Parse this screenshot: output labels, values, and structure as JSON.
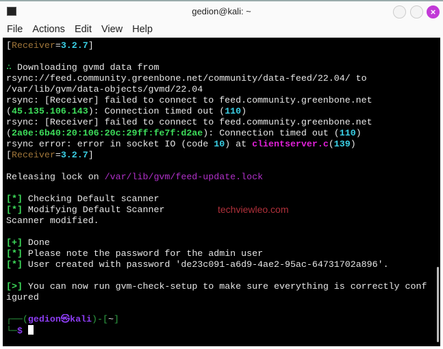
{
  "window": {
    "title": "gedion@kali: ~",
    "close_glyph": "×"
  },
  "menu": [
    "File",
    "Actions",
    "Edit",
    "View",
    "Help"
  ],
  "watermark": "techviewleo.com",
  "terminal": {
    "lines": [
      [
        [
          "",
          "["
        ],
        [
          "rcv",
          "Receiver"
        ],
        [
          "",
          "="
        ],
        [
          "cy",
          "3.2.7"
        ],
        [
          "",
          "]"
        ]
      ],
      [],
      [
        [
          "gn",
          "∴ "
        ],
        [
          "",
          "Downloading gvmd data from"
        ]
      ],
      [
        [
          "",
          "rsync://feed.community.greenbone.net/community/data-feed/22.04/ to"
        ]
      ],
      [
        [
          "",
          "/var/lib/gvm/data-objects/gvmd/22.04"
        ]
      ],
      [
        [
          "",
          "rsync: [Receiver] failed to connect to feed.community.greenbone.net"
        ]
      ],
      [
        [
          "",
          "("
        ],
        [
          "gr",
          "45.135.106.143"
        ],
        [
          "",
          "): Connection timed out ("
        ],
        [
          "cy",
          "110"
        ],
        [
          "",
          ")"
        ]
      ],
      [
        [
          "",
          "rsync: [Receiver] failed to connect to feed.community.greenbone.net"
        ]
      ],
      [
        [
          "",
          "("
        ],
        [
          "gr",
          "2a0e:6b40:20:106:20c:29ff:fe7f:d2ae"
        ],
        [
          "",
          "): Connection timed out ("
        ],
        [
          "cy",
          "110"
        ],
        [
          "",
          ")"
        ]
      ],
      [
        [
          "",
          "rsync error: error in socket IO (code "
        ],
        [
          "cy",
          "10"
        ],
        [
          "",
          ") at "
        ],
        [
          "mg",
          "clientserver.c"
        ],
        [
          "",
          "("
        ],
        [
          "cy",
          "139"
        ],
        [
          "",
          ")"
        ]
      ],
      [
        [
          "",
          "["
        ],
        [
          "rcv",
          "Receiver"
        ],
        [
          "",
          "="
        ],
        [
          "cy",
          "3.2.7"
        ],
        [
          "",
          "]"
        ]
      ],
      [],
      [
        [
          "",
          "Releasing lock on "
        ],
        [
          "pp",
          "/var/lib/gvm/feed-update.lock"
        ]
      ],
      [],
      [
        [
          "gr",
          "[*]"
        ],
        [
          "",
          " Checking Default scanner"
        ]
      ],
      [
        [
          "gr",
          "[*]"
        ],
        [
          "",
          " Modifying Default Scanner"
        ]
      ],
      [
        [
          "",
          "Scanner modified."
        ]
      ],
      [],
      [
        [
          "gr",
          "[+]"
        ],
        [
          "",
          " Done"
        ]
      ],
      [
        [
          "gr",
          "[*]"
        ],
        [
          "",
          " Please note the password for the admin user"
        ]
      ],
      [
        [
          "gr",
          "[*]"
        ],
        [
          "",
          " User created with password 'de23c091-a6d9-4ae2-95ac-64731702a896'."
        ]
      ],
      [],
      [
        [
          "gr",
          "[>]"
        ],
        [
          "",
          " You can now run gvm-check-setup to make sure everything is correctly conf"
        ]
      ],
      [
        [
          "",
          "igured"
        ]
      ],
      [],
      [
        [
          "gd",
          "┌──("
        ],
        [
          "pu",
          "gedion㉿kali"
        ],
        [
          "gd",
          ")-["
        ],
        [
          "",
          "~"
        ],
        [
          "gd",
          "]"
        ]
      ],
      [
        [
          "gd",
          "└─"
        ],
        [
          "pu",
          "$ "
        ]
      ]
    ]
  }
}
